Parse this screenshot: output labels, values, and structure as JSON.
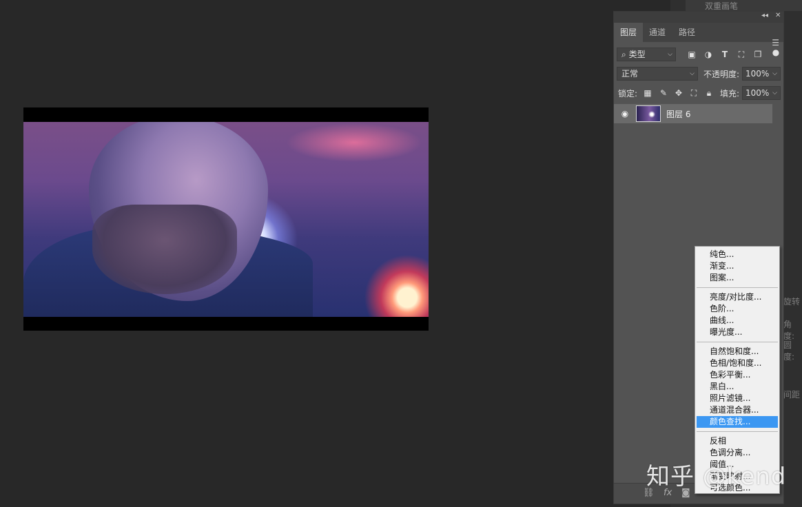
{
  "dock": {
    "top_label": "双重画笔",
    "partial_labels": [
      "旋转",
      "角度:",
      "圆度:",
      "间距"
    ]
  },
  "layers_panel": {
    "tabs": [
      {
        "label": "图层",
        "active": true
      },
      {
        "label": "通道",
        "active": false
      },
      {
        "label": "路径",
        "active": false
      }
    ],
    "filter": {
      "label": "类型",
      "icons": [
        "image-filter-icon",
        "adjustment-filter-icon",
        "text-filter-icon",
        "shape-filter-icon",
        "smart-object-filter-icon"
      ]
    },
    "blend_mode": "正常",
    "opacity_label": "不透明度:",
    "opacity_value": "100%",
    "lock_label": "锁定:",
    "fill_label": "填充:",
    "fill_value": "100%",
    "layers": [
      {
        "name": "图层 6",
        "visible": true,
        "selected": true
      }
    ]
  },
  "context_menu": {
    "groups": [
      [
        "纯色...",
        "渐变...",
        "图案..."
      ],
      [
        "亮度/对比度...",
        "色阶...",
        "曲线...",
        "曝光度..."
      ],
      [
        "自然饱和度...",
        "色相/饱和度...",
        "色彩平衡...",
        "黑白...",
        "照片滤镜...",
        "通道混合器...",
        "颜色查找..."
      ],
      [
        "反相",
        "色调分离...",
        "阈值...",
        "渐变映射...",
        "可选颜色..."
      ]
    ],
    "highlighted": "颜色查找...",
    "highlight_color": "#3b97f2"
  },
  "watermark": "知乎 @kend"
}
